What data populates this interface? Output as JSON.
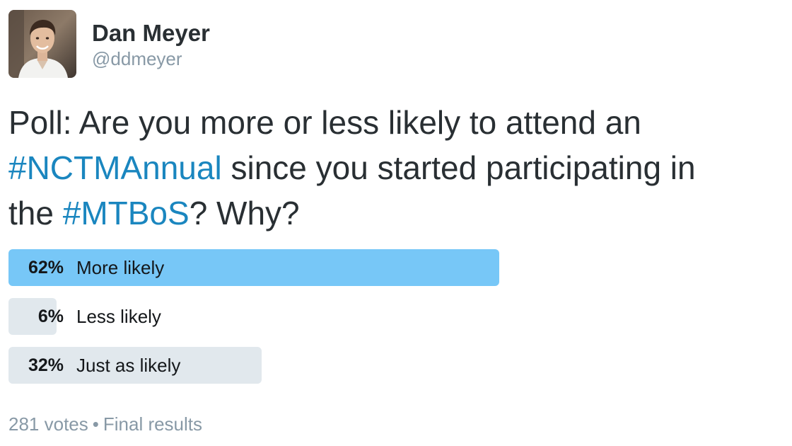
{
  "author": {
    "name": "Dan Meyer",
    "handle": "@ddmeyer"
  },
  "tweet": {
    "line1": "Poll: Are you more or less likely to attend an",
    "line2_hashtag": "#NCTMAnnual",
    "line2_rest": " since you started participating in",
    "line3_prefix": "the ",
    "line3_hashtag": "#MTBoS",
    "line3_rest": "? Why?"
  },
  "poll": {
    "choices": [
      {
        "percent_label": "62%",
        "label": "More likely",
        "percent": 62,
        "winner": true
      },
      {
        "percent_label": "6%",
        "label": "Less likely",
        "percent": 6,
        "winner": false
      },
      {
        "percent_label": "32%",
        "label": "Just as likely",
        "percent": 32,
        "winner": false
      }
    ],
    "votes": "281 votes",
    "separator": "•",
    "status": "Final results"
  },
  "colors": {
    "winner_bar": "#77c7f7",
    "bar": "#e1e8ed",
    "hashtag": "#1a86bf",
    "muted_text": "#8899a6"
  },
  "icons": {
    "avatar": "profile-photo"
  }
}
